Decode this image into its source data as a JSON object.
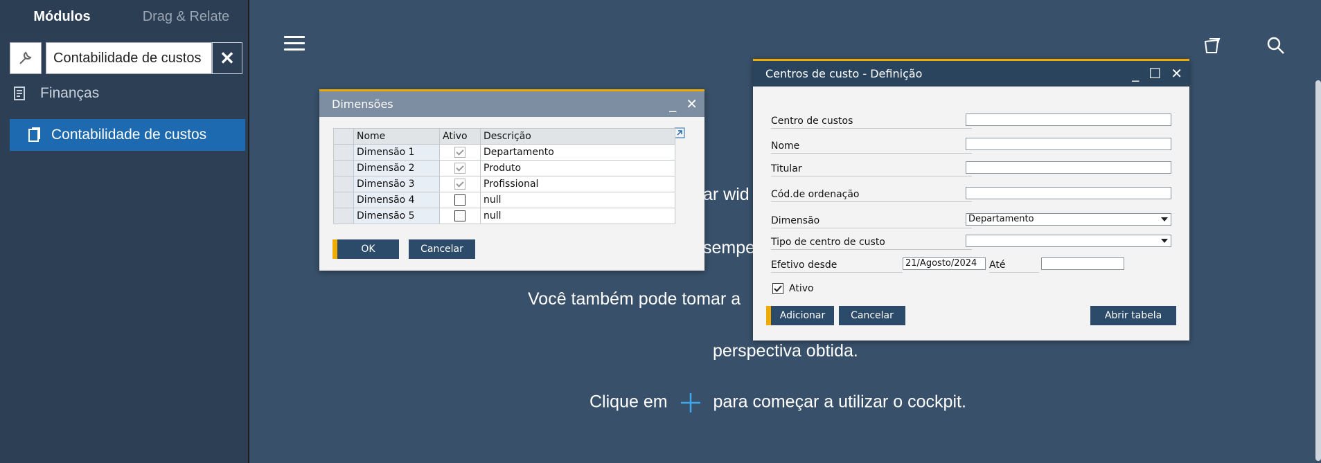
{
  "sidebar": {
    "tab_modules": "Módulos",
    "tab_drag": "Drag & Relate",
    "search_value": "Contabilidade de custos",
    "items": [
      {
        "label": "Finanças"
      },
      {
        "label": "Contabilidade de custos"
      }
    ]
  },
  "background": {
    "line1": "ar wid",
    "line2": "sempe",
    "line3": "Você também pode tomar a",
    "line4": "perspectiva obtida.",
    "line5a": "Clique em",
    "line5b": "para começar a utilizar o cockpit."
  },
  "dim_window": {
    "title": "Dimensões",
    "headers": [
      "Nome",
      "Ativo",
      "Descrição"
    ],
    "rows": [
      {
        "name": "Dimensão 1",
        "active": true,
        "desc": "Departamento"
      },
      {
        "name": "Dimensão 2",
        "active": true,
        "desc": "Produto"
      },
      {
        "name": "Dimensão 3",
        "active": true,
        "desc": "Profissional"
      },
      {
        "name": "Dimensão 4",
        "active": false,
        "desc": "null"
      },
      {
        "name": "Dimensão 5",
        "active": false,
        "desc": "null"
      }
    ],
    "ok": "OK",
    "cancel": "Cancelar"
  },
  "cc_window": {
    "title": "Centros de custo - Definição",
    "labels": {
      "centro": "Centro de custos",
      "nome": "Nome",
      "titular": "Titular",
      "ordenacao": "Cód.de ordenação",
      "dimensao": "Dimensão",
      "tipo": "Tipo de centro de custo",
      "efetivo": "Efetivo desde",
      "ate": "Até",
      "ativo": "Ativo"
    },
    "values": {
      "dimensao": "Departamento",
      "efetivo": "21/Agosto/2024"
    },
    "buttons": {
      "add": "Adicionar",
      "cancel": "Cancelar",
      "open": "Abrir tabela"
    }
  },
  "colors": {
    "accent": "#f0ab00",
    "selected": "#1d6ab0",
    "button": "#2c4a69"
  }
}
